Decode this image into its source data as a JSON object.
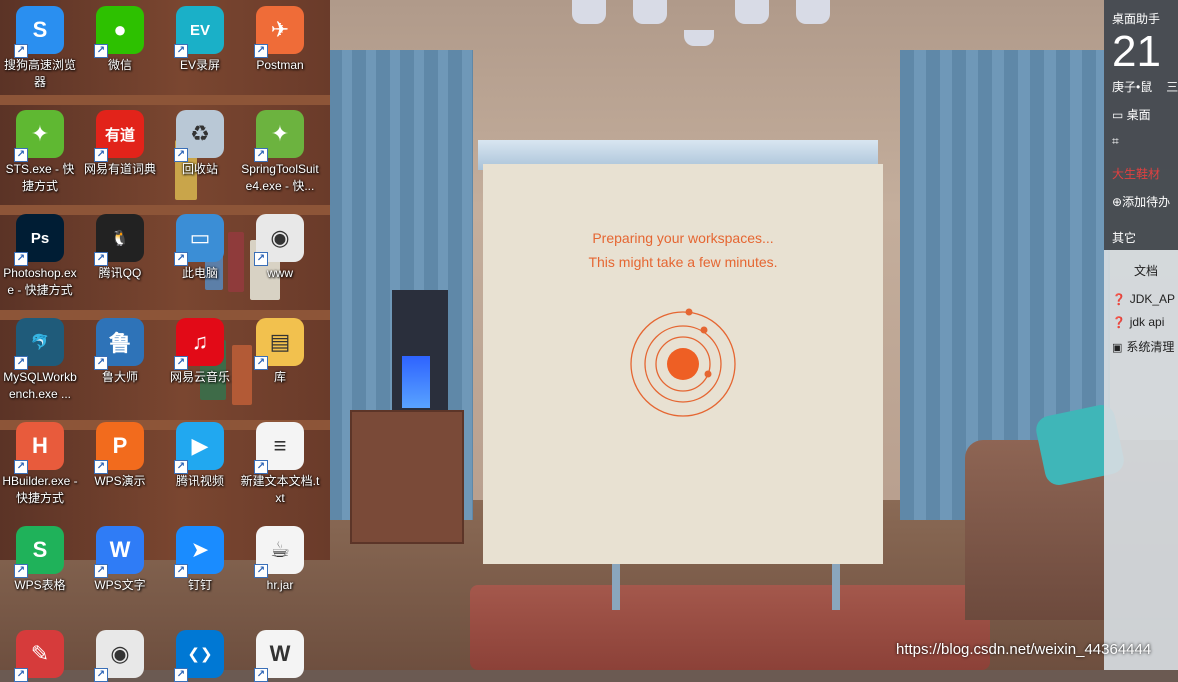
{
  "desktop_icons": [
    {
      "label": "搜狗高速浏览器",
      "icon": "sogou-browser-icon",
      "color": "#2a8ff0",
      "glyph": "S"
    },
    {
      "label": "微信",
      "icon": "wechat-icon",
      "color": "#2dc100",
      "glyph": "●"
    },
    {
      "label": "EV录屏",
      "icon": "ev-recorder-icon",
      "color": "#1ab0c8",
      "glyph": "EV"
    },
    {
      "label": "Postman",
      "icon": "postman-icon",
      "color": "#ef6c38",
      "glyph": "✈"
    },
    {
      "label": "STS.exe - 快捷方式",
      "icon": "spring-sts-icon",
      "color": "#5fb832",
      "glyph": "✦"
    },
    {
      "label": "网易有道词典",
      "icon": "youdao-icon",
      "color": "#e2231a",
      "glyph": "有道"
    },
    {
      "label": "回收站",
      "icon": "recycle-bin-icon",
      "color": "#b9c8d6",
      "glyph": "♻"
    },
    {
      "label": "SpringToolSuite4.exe - 快...",
      "icon": "spring-tool-suite-icon",
      "color": "#6cb33f",
      "glyph": "✦"
    },
    {
      "label": "Photoshop.exe - 快捷方式",
      "icon": "photoshop-icon",
      "color": "#001d34",
      "glyph": "Ps"
    },
    {
      "label": "腾讯QQ",
      "icon": "qq-icon",
      "color": "#222222",
      "glyph": "🐧"
    },
    {
      "label": "此电脑",
      "icon": "this-pc-icon",
      "color": "#3b8ed6",
      "glyph": "▭"
    },
    {
      "label": "www",
      "icon": "chrome-shortcut-icon",
      "color": "#e8e8e8",
      "glyph": "◉"
    },
    {
      "label": "MySQLWorkbench.exe ...",
      "icon": "mysql-workbench-icon",
      "color": "#1f5b7a",
      "glyph": "🐬"
    },
    {
      "label": "鲁大师",
      "icon": "ludashi-icon",
      "color": "#2e73b8",
      "glyph": "鲁"
    },
    {
      "label": "网易云音乐",
      "icon": "netease-music-icon",
      "color": "#e20a17",
      "glyph": "♫"
    },
    {
      "label": "库",
      "icon": "library-folder-icon",
      "color": "#f2c14e",
      "glyph": "▤"
    },
    {
      "label": "HBuilder.exe - 快捷方式",
      "icon": "hbuilder-icon",
      "color": "#e85b3c",
      "glyph": "H"
    },
    {
      "label": "WPS演示",
      "icon": "wps-presentation-icon",
      "color": "#f26b1d",
      "glyph": "P"
    },
    {
      "label": "腾讯视频",
      "icon": "tencent-video-icon",
      "color": "#21a8f0",
      "glyph": "▶"
    },
    {
      "label": "新建文本文档.txt",
      "icon": "text-document-icon",
      "color": "#f4f4f4",
      "glyph": "≡"
    },
    {
      "label": "WPS表格",
      "icon": "wps-spreadsheet-icon",
      "color": "#1fb25a",
      "glyph": "S"
    },
    {
      "label": "WPS文字",
      "icon": "wps-writer-icon",
      "color": "#2f7cf6",
      "glyph": "W"
    },
    {
      "label": "钉钉",
      "icon": "dingtalk-icon",
      "color": "#1a8cff",
      "glyph": "➤"
    },
    {
      "label": "hr.jar",
      "icon": "java-jar-icon",
      "color": "#f4f4f4",
      "glyph": "☕"
    },
    {
      "label": "",
      "icon": "notepad-pencil-icon",
      "color": "#d63b3b",
      "glyph": "✎"
    },
    {
      "label": "",
      "icon": "chrome-icon",
      "color": "#e8e8e8",
      "glyph": "◉"
    },
    {
      "label": "",
      "icon": "vscode-icon",
      "color": "#0078d4",
      "glyph": "❮❯"
    },
    {
      "label": "",
      "icon": "word-document-icon",
      "color": "#f4f4f4",
      "glyph": "W"
    }
  ],
  "splash": {
    "line1": "Preparing your workspaces...",
    "line2": "This might take a few minutes.",
    "accent": "#e56632",
    "background": "#e8e1d2"
  },
  "widget": {
    "title": "桌面助手",
    "day": "21",
    "lunar": "庚子•鼠",
    "lunar_extra": "三",
    "desktop": "桌面",
    "red_text": "大生鞋材",
    "add_todo": "添加待办",
    "other": "其它",
    "docs_header": "文档",
    "docs": [
      {
        "name": "JDK_AP",
        "icon": "help-doc-icon"
      },
      {
        "name": "jdk api",
        "icon": "help-doc-icon"
      },
      {
        "name": "系统清理",
        "icon": "system-clean-icon"
      }
    ]
  },
  "watermark": "https://blog.csdn.net/weixin_44364444"
}
